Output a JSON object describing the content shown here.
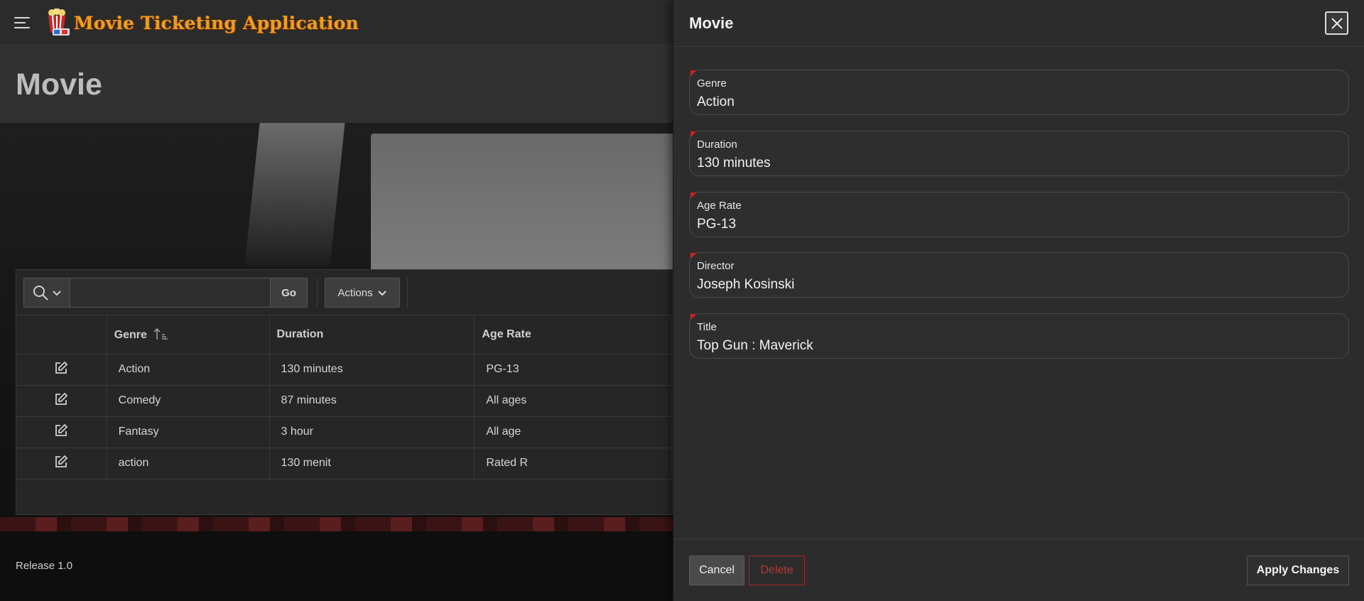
{
  "app": {
    "title": "Movie Ticketing Application"
  },
  "page": {
    "title": "Movie"
  },
  "toolbar": {
    "search_value": "",
    "go_label": "Go",
    "actions_label": "Actions"
  },
  "report": {
    "columns": [
      "",
      "Genre",
      "Duration",
      "Age Rate"
    ],
    "rows": [
      {
        "genre": "Action",
        "duration": "130 minutes",
        "age_rate": "PG-13"
      },
      {
        "genre": "Comedy",
        "duration": "87 minutes",
        "age_rate": "All ages"
      },
      {
        "genre": "Fantasy",
        "duration": "3 hour",
        "age_rate": "All age"
      },
      {
        "genre": "action",
        "duration": "130 menit",
        "age_rate": "Rated R"
      }
    ]
  },
  "footer": {
    "release": "Release 1.0"
  },
  "drawer": {
    "title": "Movie",
    "fields": [
      {
        "label": "Genre",
        "value": "Action"
      },
      {
        "label": "Duration",
        "value": "130 minutes"
      },
      {
        "label": "Age Rate",
        "value": "PG-13"
      },
      {
        "label": "Director",
        "value": "Joseph Kosinski"
      },
      {
        "label": "Title",
        "value": "Top Gun : Maverick"
      }
    ],
    "cancel_label": "Cancel",
    "delete_label": "Delete",
    "apply_label": "Apply Changes"
  },
  "colors": {
    "brand_title": "#e8a020",
    "required_marker": "#d42020",
    "delete": "#b02525"
  },
  "icons": {
    "menu": "hamburger-menu-icon",
    "logo": "popcorn-logo-icon",
    "search": "search-icon",
    "chevron": "chevron-down-icon",
    "sort": "sort-ascending-icon",
    "edit": "edit-icon",
    "close": "close-icon"
  }
}
